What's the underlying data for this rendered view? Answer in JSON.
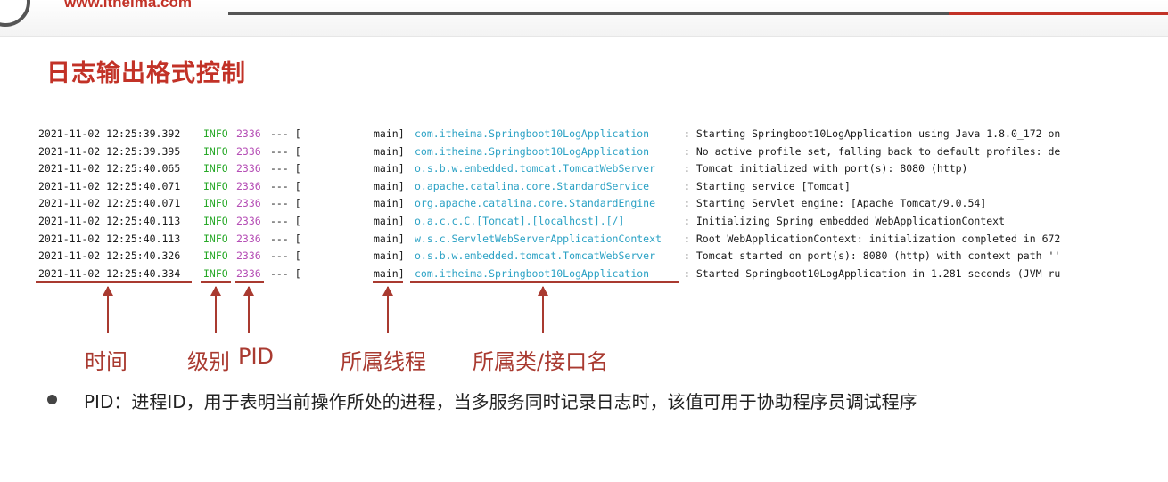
{
  "header": {
    "url": "www.itheima.com"
  },
  "slide": {
    "title": "日志输出格式控制"
  },
  "log_rows": [
    {
      "time": "2021-11-02 12:25:39.392",
      "level": "INFO",
      "pid": "2336",
      "sep": "--- [",
      "thread": "main]",
      "logger": "com.itheima.Springboot10LogApplication",
      "message": ": Starting Springboot10LogApplication using Java 1.8.0_172 on"
    },
    {
      "time": "2021-11-02 12:25:39.395",
      "level": "INFO",
      "pid": "2336",
      "sep": "--- [",
      "thread": "main]",
      "logger": "com.itheima.Springboot10LogApplication",
      "message": ": No active profile set, falling back to default profiles: de"
    },
    {
      "time": "2021-11-02 12:25:40.065",
      "level": "INFO",
      "pid": "2336",
      "sep": "--- [",
      "thread": "main]",
      "logger": "o.s.b.w.embedded.tomcat.TomcatWebServer",
      "message": ": Tomcat initialized with port(s): 8080 (http)"
    },
    {
      "time": "2021-11-02 12:25:40.071",
      "level": "INFO",
      "pid": "2336",
      "sep": "--- [",
      "thread": "main]",
      "logger": "o.apache.catalina.core.StandardService",
      "message": ": Starting service [Tomcat]"
    },
    {
      "time": "2021-11-02 12:25:40.071",
      "level": "INFO",
      "pid": "2336",
      "sep": "--- [",
      "thread": "main]",
      "logger": "org.apache.catalina.core.StandardEngine",
      "message": ": Starting Servlet engine: [Apache Tomcat/9.0.54]"
    },
    {
      "time": "2021-11-02 12:25:40.113",
      "level": "INFO",
      "pid": "2336",
      "sep": "--- [",
      "thread": "main]",
      "logger": "o.a.c.c.C.[Tomcat].[localhost].[/]",
      "message": ": Initializing Spring embedded WebApplicationContext"
    },
    {
      "time": "2021-11-02 12:25:40.113",
      "level": "INFO",
      "pid": "2336",
      "sep": "--- [",
      "thread": "main]",
      "logger": "w.s.c.ServletWebServerApplicationContext",
      "message": ": Root WebApplicationContext: initialization completed in 672"
    },
    {
      "time": "2021-11-02 12:25:40.326",
      "level": "INFO",
      "pid": "2336",
      "sep": "--- [",
      "thread": "main]",
      "logger": "o.s.b.w.embedded.tomcat.TomcatWebServer",
      "message": ": Tomcat started on port(s): 8080 (http) with context path ''"
    },
    {
      "time": "2021-11-02 12:25:40.334",
      "level": "INFO",
      "pid": "2336",
      "sep": "--- [",
      "thread": "main]",
      "logger": "com.itheima.Springboot10LogApplication",
      "message": ": Started Springboot10LogApplication in 1.281 seconds (JVM ru"
    }
  ],
  "labels": {
    "time": "时间",
    "level": "级别",
    "pid": "PID",
    "thread": "所属线程",
    "logger": "所属类/接口名"
  },
  "bullet": {
    "text": "PID：进程ID，用于表明当前操作所处的进程，当多服务同时记录日志时，该值可用于协助程序员调试程序"
  },
  "colors": {
    "title": "#c23227",
    "annotation": "#a93a30",
    "log_level": "#27a827",
    "log_pid": "#b54db5",
    "log_logger": "#2aa1c4"
  }
}
